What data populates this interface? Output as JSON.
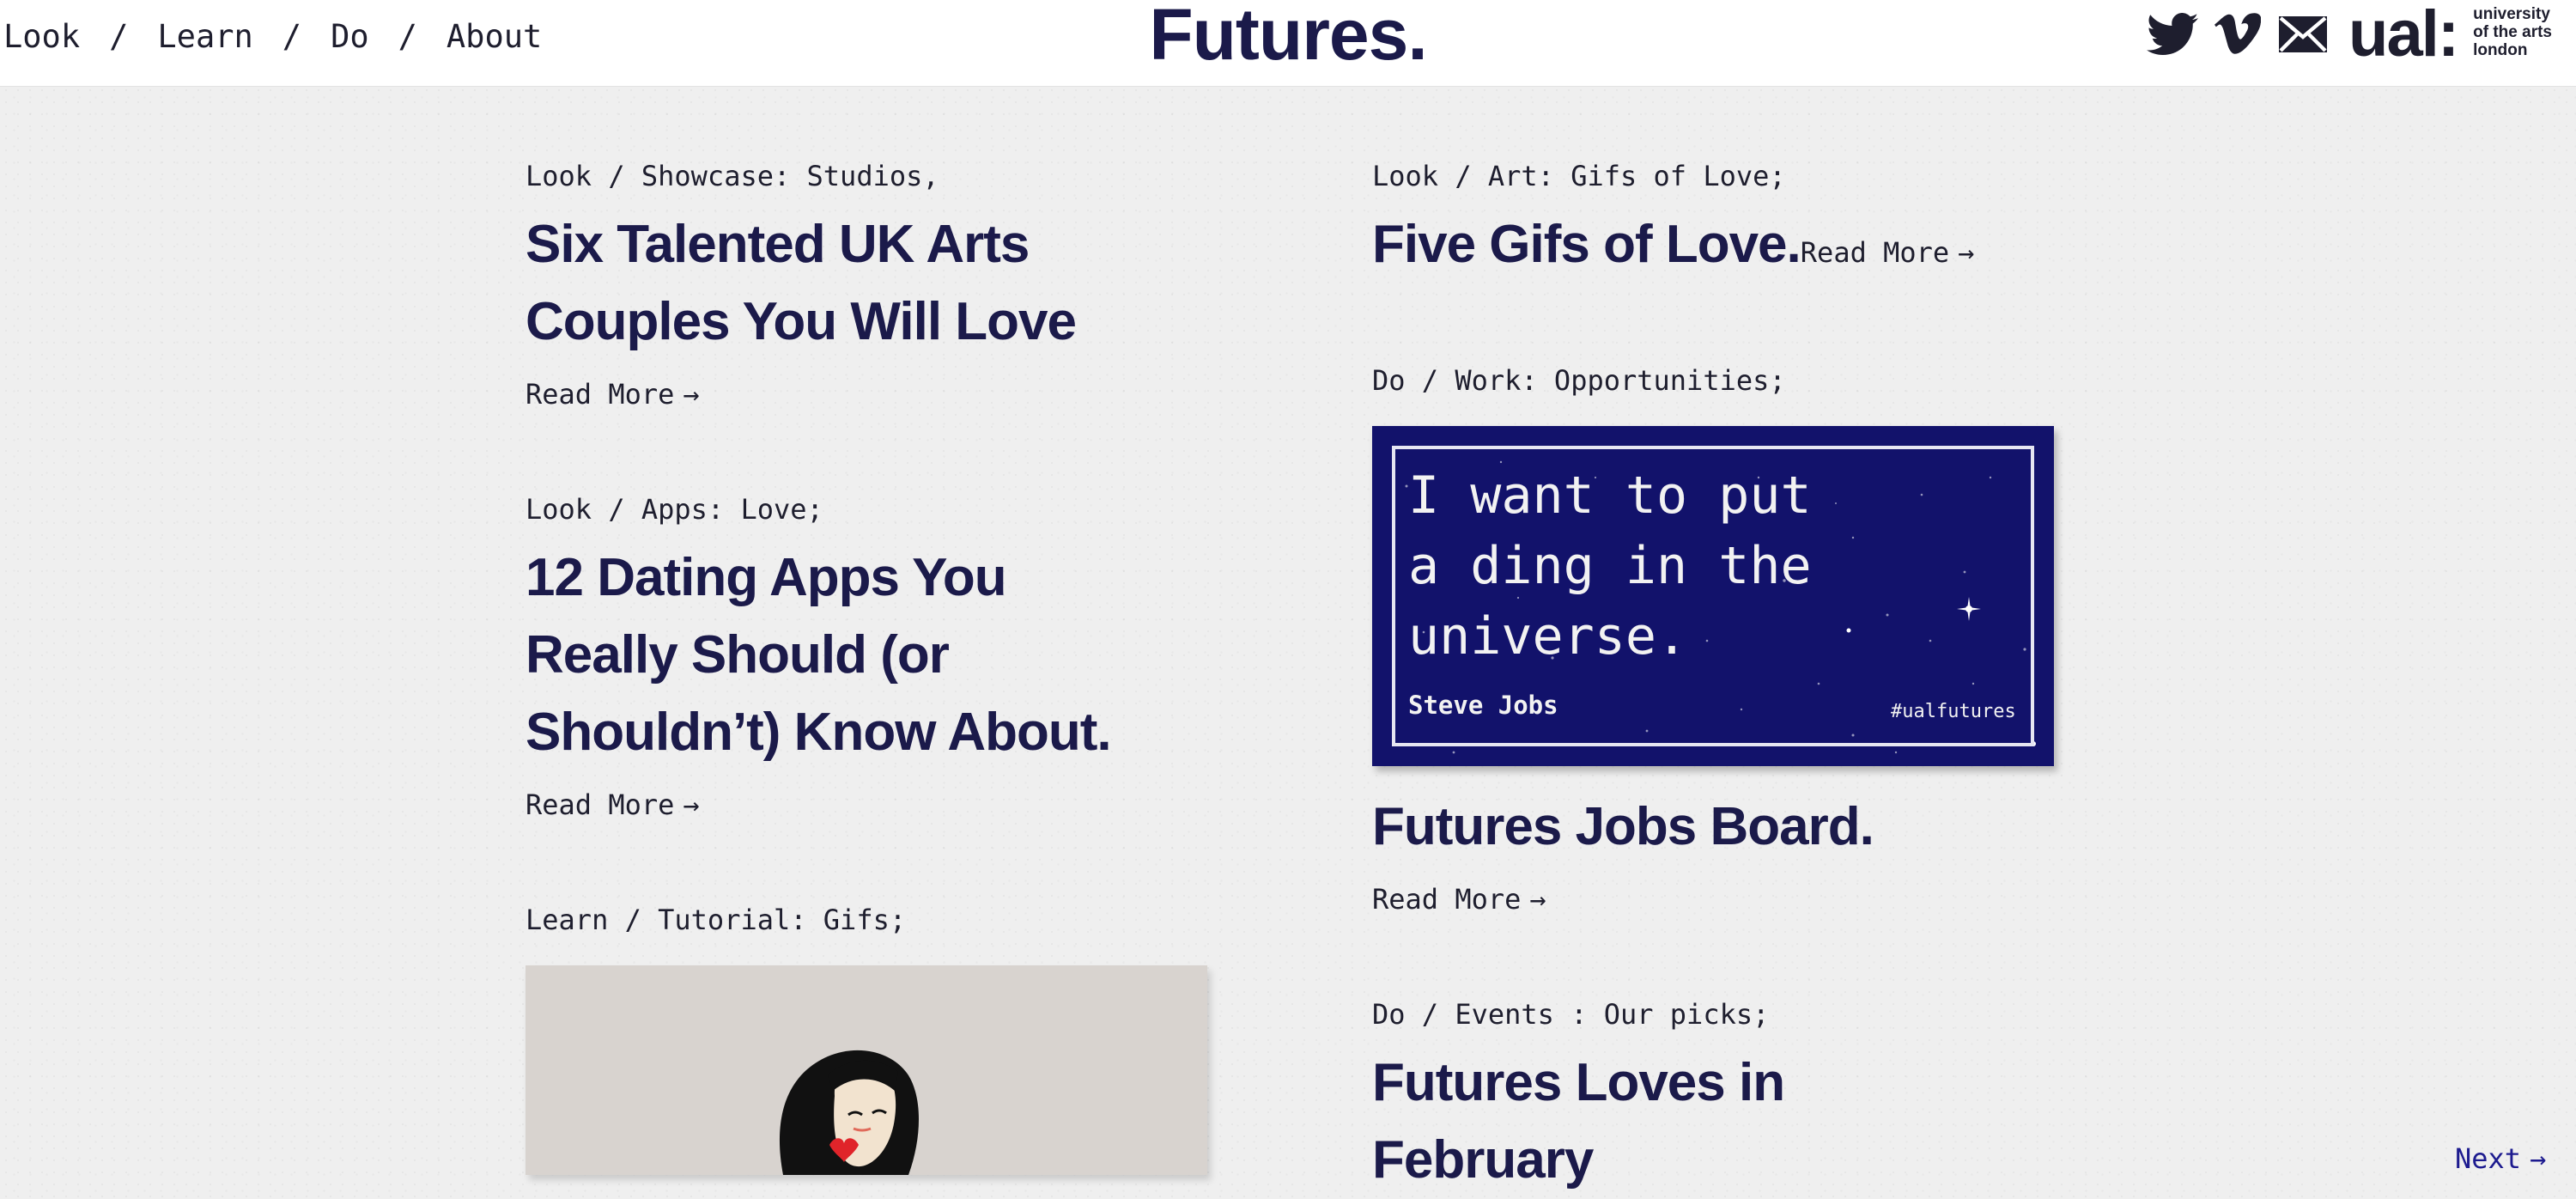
{
  "nav": {
    "items": [
      "Look",
      "Learn",
      "Do",
      "About"
    ],
    "separator": "/"
  },
  "site": {
    "title": "Futures.",
    "ual_mark": "ual:",
    "ual_line1": "university",
    "ual_line2": "of the arts",
    "ual_line3": "london"
  },
  "icons": [
    "twitter-icon",
    "vimeo-icon",
    "mail-icon"
  ],
  "articles": {
    "couples": {
      "category": "Look / Showcase: Studios,",
      "title_line1": "Six Talented UK Arts",
      "title_line2": "Couples You Will Love",
      "read_more": "Read More"
    },
    "dating": {
      "category": "Look / Apps: Love;",
      "title_line1": "12 Dating Apps You",
      "title_line2": "Really Should (or",
      "title_line3": "Shouldn’t) Know About.",
      "read_more": "Read More"
    },
    "tutorial": {
      "category": "Learn / Tutorial: Gifs;"
    },
    "gifs": {
      "category": "Look / Art: Gifs of Love;",
      "title": "Five Gifs of Love.",
      "read_more": "Read More"
    },
    "jobs": {
      "category": "Do / Work: Opportunities;",
      "quote_line1": "I want to put",
      "quote_line2": "a ding in the",
      "quote_line3": "universe.",
      "quote_author": "Steve Jobs",
      "quote_tag": "#ualfutures",
      "title": "Futures Jobs Board.",
      "read_more": "Read More"
    },
    "events": {
      "category": "Do / Events : Our picks;",
      "title_line1": "Futures Loves in",
      "title_line2": "February"
    }
  },
  "pagination": {
    "next": "Next"
  },
  "colors": {
    "brand_navy": "#1b1a4a",
    "card_blue": "#12126b",
    "link_blue": "#1d1b8f",
    "background": "#efefef"
  }
}
